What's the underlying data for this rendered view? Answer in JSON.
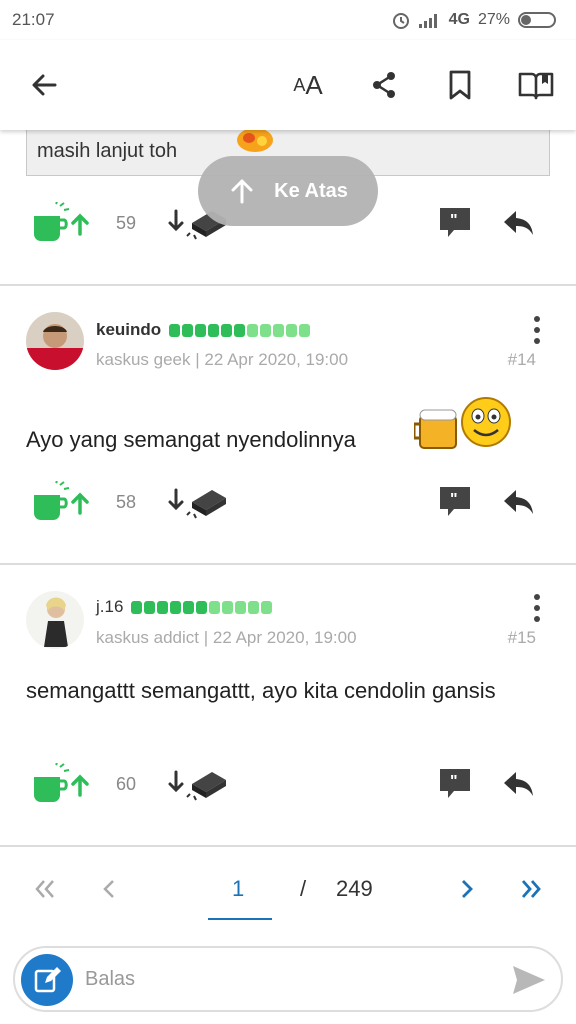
{
  "status_bar": {
    "time": "21:07",
    "network": "4G",
    "battery": "27%"
  },
  "app_bar": {
    "font_size_label_small": "A",
    "font_size_label_large": "A"
  },
  "quote": {
    "text": "masih lanjut toh"
  },
  "ke_atas": {
    "label": "Ke Atas"
  },
  "posts": [
    {
      "votes": "59"
    },
    {
      "username": "keuindo",
      "rank": "kaskus geek",
      "datetime": "22 Apr 2020, 19:00",
      "post_number": "#14",
      "body": "Ayo yang semangat nyendolinnya",
      "votes": "58"
    },
    {
      "username": "j.16",
      "rank": "kaskus addict",
      "datetime": "22 Apr 2020, 19:00",
      "post_number": "#15",
      "body": "semangattt semangattt, ayo kita cendolin gansis",
      "votes": "60"
    }
  ],
  "pagination": {
    "current_page": "1",
    "separator": "/",
    "total_pages": "249"
  },
  "reply": {
    "placeholder": "Balas"
  },
  "colors": {
    "accent": "#1a73b8",
    "cendol_green": "#2ebd59",
    "rep_dark": "#2ebd59",
    "rep_light": "#7ee08a"
  }
}
